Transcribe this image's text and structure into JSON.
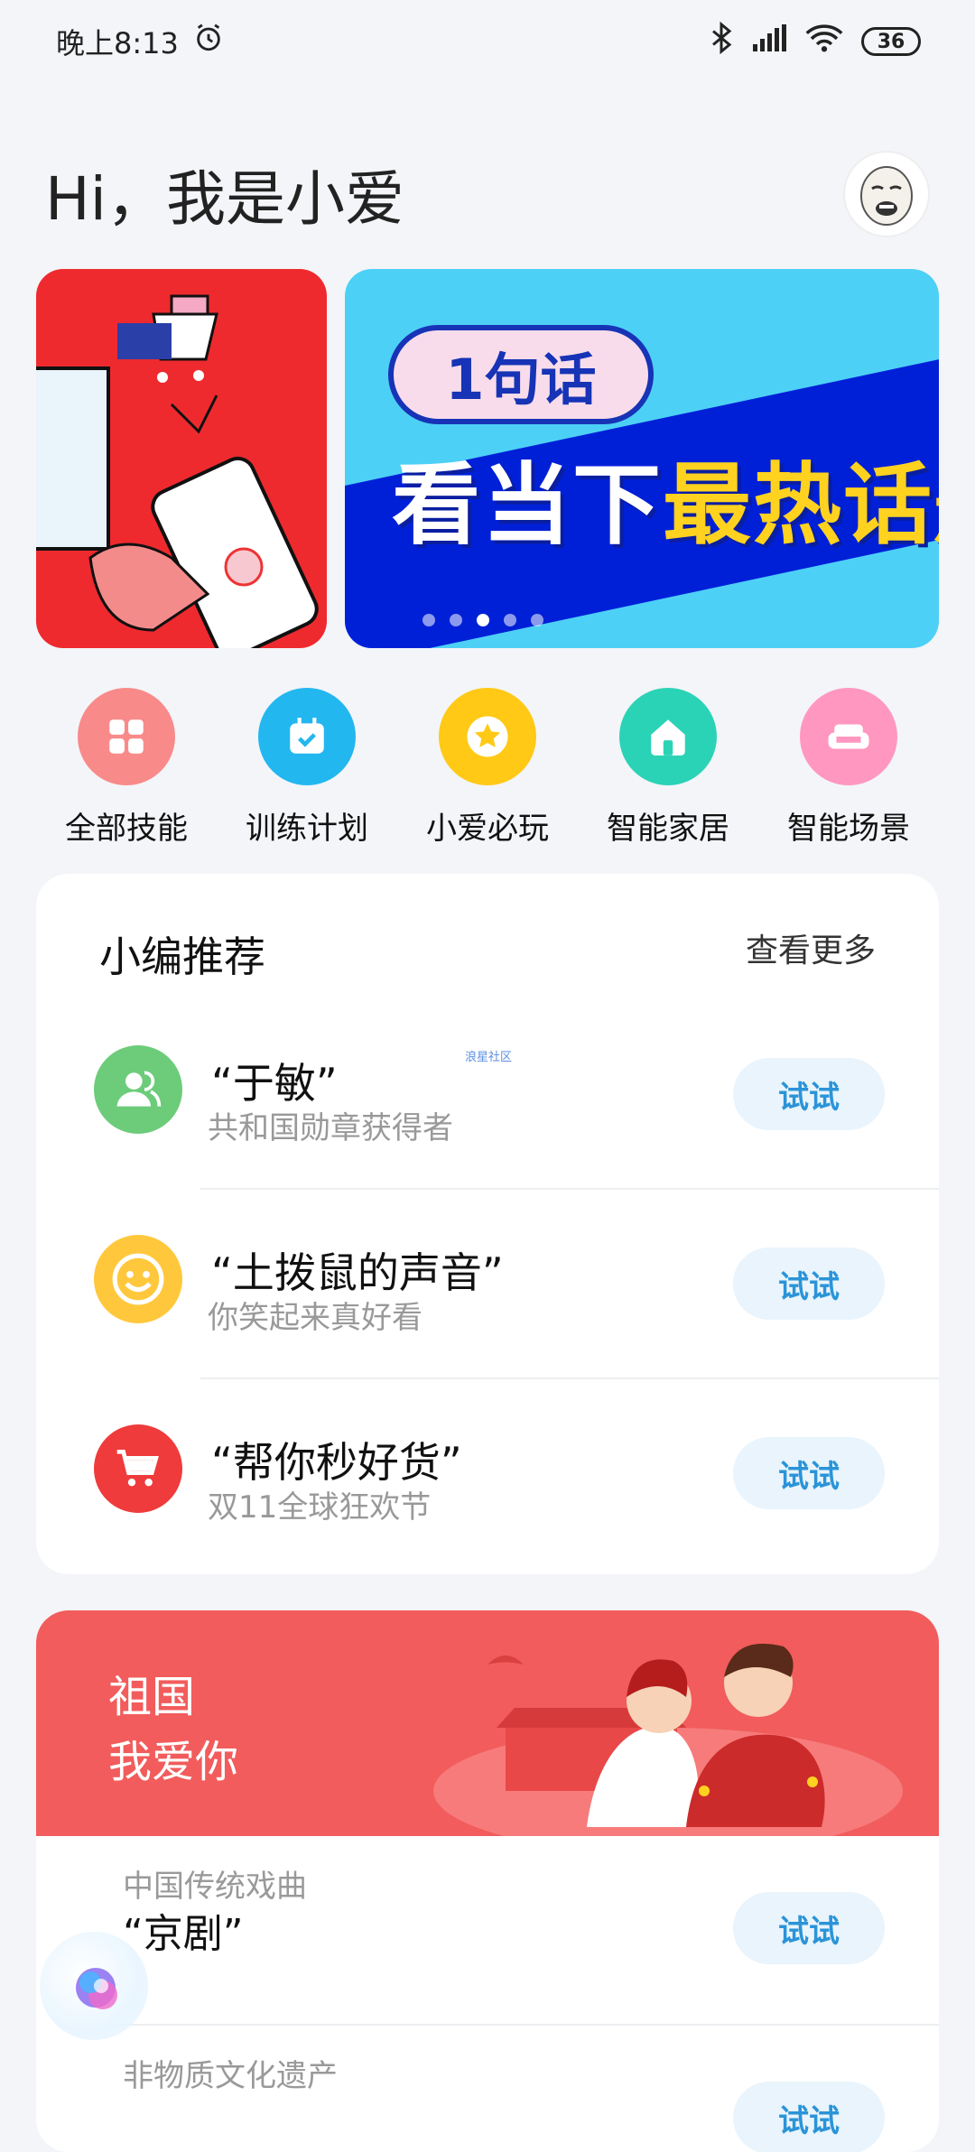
{
  "status_bar": {
    "time": "晚上8:13",
    "battery": "36"
  },
  "header": {
    "greeting": "Hi，我是小爱"
  },
  "banner": {
    "pill": "1句话",
    "headline_white": "看当下",
    "headline_yellow": "最热话题"
  },
  "quick_actions": [
    {
      "label": "全部技能",
      "color": "#f98a8a",
      "icon": "grid-icon"
    },
    {
      "label": "训练计划",
      "color": "#23b7f0",
      "icon": "calendar-icon"
    },
    {
      "label": "小爱必玩",
      "color": "#ffc915",
      "icon": "star-icon"
    },
    {
      "label": "智能家居",
      "color": "#2bd3b6",
      "icon": "home-icon"
    },
    {
      "label": "智能场景",
      "color": "#ff97c0",
      "icon": "sofa-icon"
    }
  ],
  "recommend": {
    "title": "小编推荐",
    "more": "查看更多",
    "watermark": "浪星社区",
    "items": [
      {
        "title": "“于敏”",
        "subtitle": "共和国勋章获得者",
        "button": "试试",
        "color": "#6ccc7a",
        "icon": "user-icon"
      },
      {
        "title": "“土拨鼠的声音”",
        "subtitle": "你笑起来真好看",
        "button": "试试",
        "color": "#ffc83c",
        "icon": "smile-icon"
      },
      {
        "title": "“帮你秒好货”",
        "subtitle": "双11全球狂欢节",
        "button": "试试",
        "color": "#ef3b3b",
        "icon": "cart-icon"
      }
    ]
  },
  "patriotic": {
    "title": "祖国\n我爱你",
    "items": [
      {
        "subtitle": "中国传统戏曲",
        "title": "“京剧”",
        "button": "试试"
      },
      {
        "subtitle": "非物质文化遗产",
        "title": "",
        "button": "试试"
      }
    ]
  }
}
